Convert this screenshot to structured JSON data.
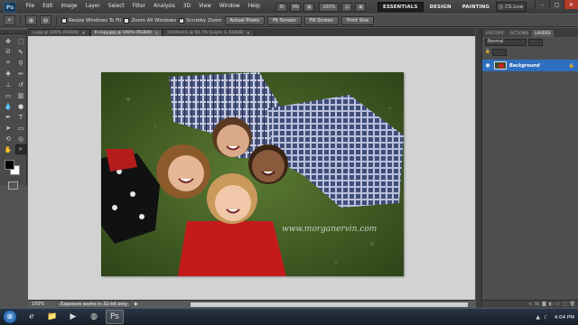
{
  "app": {
    "logo": "Ps"
  },
  "menubar": {
    "items": [
      "File",
      "Edit",
      "Image",
      "Layer",
      "Select",
      "Filter",
      "Analysis",
      "3D",
      "View",
      "Window",
      "Help"
    ],
    "zoom_value": "100%",
    "workspaces": [
      "ESSENTIALS",
      "DESIGN",
      "PAINTING"
    ],
    "more_chevron": "»",
    "cslive_label": "CS Live",
    "window_controls": [
      "–",
      "□",
      "✕"
    ]
  },
  "options_bar": {
    "tool_icon": "zoom-icon",
    "resize_windows_label": "Resize Windows To Fit",
    "resize_windows_checked": false,
    "zoom_all_label": "Zoom All Windows",
    "zoom_all_checked": false,
    "scrubby_zoom_label": "Scrubby Zoom",
    "scrubby_zoom_checked": true,
    "buttons": [
      "Actual Pixels",
      "Fit Screen",
      "Fill Screen",
      "Print Size"
    ]
  },
  "doc_tabs": [
    {
      "label": "o.jpg @ 100% (RGB/8)",
      "active": false
    },
    {
      "label": "6-copy.jpg @ 100% (RGB/8)",
      "active": true
    },
    {
      "label": "Untitled-1 @ 66.7% (Layer 1, RGB/8)",
      "active": false
    }
  ],
  "document": {
    "zoom": "100%",
    "status_text": "Exposure works in 32-bit only",
    "watermark": "www.morganervin.com"
  },
  "panel": {
    "tabs": [
      {
        "label": "HISTORY",
        "active": false
      },
      {
        "label": "ACTIONS",
        "active": false
      },
      {
        "label": "LAYERS",
        "active": true
      }
    ],
    "blend_mode": "Normal",
    "layers": [
      {
        "name": "Background",
        "visible": true,
        "locked": true
      }
    ]
  },
  "taskbar": {
    "start_icon": "windows-start-icon",
    "apps": [
      {
        "icon": "internet-explorer-icon",
        "active": false
      },
      {
        "icon": "folder-icon",
        "active": false
      },
      {
        "icon": "media-player-icon",
        "active": false
      },
      {
        "icon": "firefox-icon",
        "active": false
      },
      {
        "icon": "photoshop-icon",
        "active": true
      }
    ],
    "clock": "4:04 PM"
  },
  "colors": {
    "accent_layer": "#2f6fbf",
    "canvas_bg": "#d2d2d2",
    "foreground": "#000000",
    "background": "#ffffff"
  }
}
